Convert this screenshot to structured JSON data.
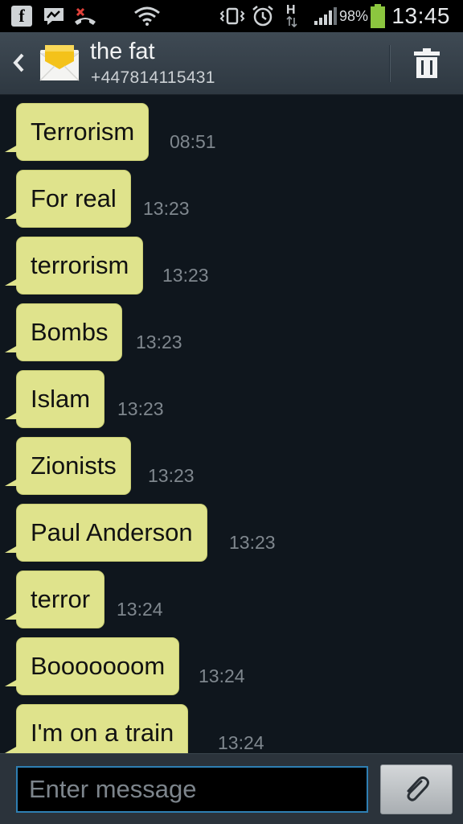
{
  "status_bar": {
    "battery_percent": "98%",
    "time": "13:45",
    "network_indicator": "H",
    "icons": [
      "facebook-icon",
      "messenger-icon",
      "missed-call-icon",
      "wifi-icon",
      "vibrate-icon",
      "alarm-icon",
      "signal-icon",
      "battery-icon"
    ]
  },
  "header": {
    "contact_name": "the fat",
    "contact_number": "+447814115431",
    "back_icon": "chevron-left-icon",
    "app_icon": "envelope-icon",
    "delete_icon": "trash-icon"
  },
  "messages": [
    {
      "text": "Terrorism",
      "time": "08:51"
    },
    {
      "text": "For real",
      "time": "13:23"
    },
    {
      "text": "terrorism",
      "time": "13:23"
    },
    {
      "text": "Bombs",
      "time": "13:23"
    },
    {
      "text": "Islam",
      "time": "13:23"
    },
    {
      "text": "Zionists",
      "time": "13:23"
    },
    {
      "text": "Paul Anderson",
      "time": "13:23"
    },
    {
      "text": "terror",
      "time": "13:24"
    },
    {
      "text": "Booooooom",
      "time": "13:24"
    },
    {
      "text": "I'm on a train",
      "time": "13:24"
    }
  ],
  "composer": {
    "placeholder": "Enter message",
    "attach_icon": "paperclip-icon"
  },
  "colors": {
    "bubble": "#dfe38c",
    "background": "#0f161d",
    "accent": "#2e7fb3"
  }
}
